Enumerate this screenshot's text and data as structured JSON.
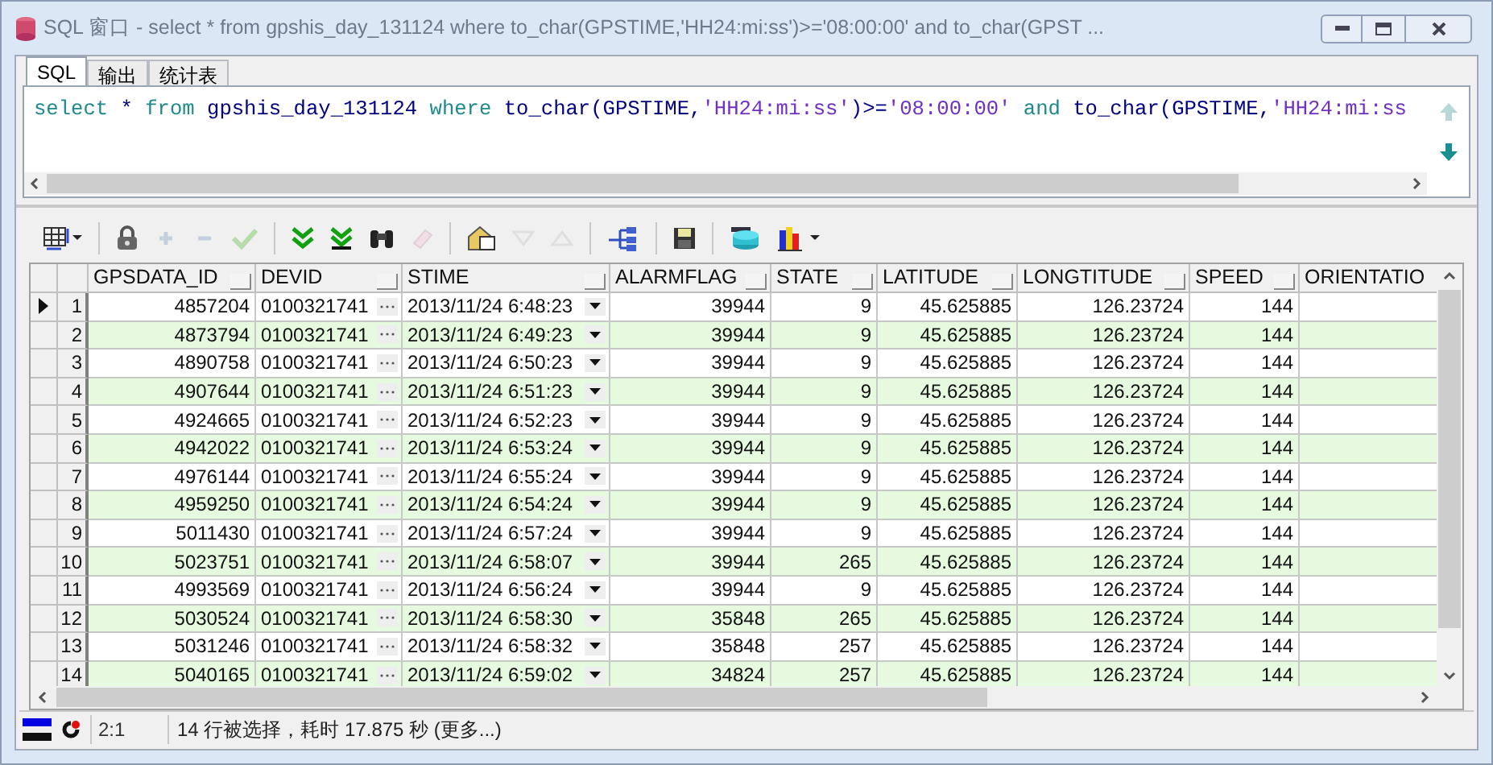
{
  "window": {
    "title": "SQL 窗口 - select * from gpshis_day_131124 where to_char(GPSTIME,'HH24:mi:ss')>='08:00:00' and to_char(GPST ..."
  },
  "tabs": [
    {
      "label": "SQL",
      "selected": true
    },
    {
      "label": "输出",
      "selected": false
    },
    {
      "label": "统计表",
      "selected": false
    }
  ],
  "sql": {
    "tokens": [
      {
        "text": "select",
        "kind": "keyword"
      },
      {
        "text": " * ",
        "kind": "plain"
      },
      {
        "text": "from",
        "kind": "keyword"
      },
      {
        "text": " gpshis_day_131124 ",
        "kind": "plain"
      },
      {
        "text": "where",
        "kind": "keyword"
      },
      {
        "text": " to_char(GPSTIME,",
        "kind": "plain"
      },
      {
        "text": "'HH24:mi:ss'",
        "kind": "string"
      },
      {
        "text": ")>=",
        "kind": "plain"
      },
      {
        "text": "'08:00:00'",
        "kind": "string"
      },
      {
        "text": " and",
        "kind": "keyword"
      },
      {
        "text": " to_char(GPSTIME,",
        "kind": "plain"
      },
      {
        "text": "'HH24:mi:ss",
        "kind": "string"
      }
    ]
  },
  "toolbar": [
    [
      {
        "kind": "grid",
        "disabled": false
      }
    ],
    [
      {
        "kind": "lock",
        "disabled": false
      },
      {
        "kind": "add",
        "disabled": true
      },
      {
        "kind": "remove",
        "disabled": true
      },
      {
        "kind": "post",
        "disabled": true
      }
    ],
    [
      {
        "kind": "fetch-next",
        "disabled": false
      },
      {
        "kind": "fetch-last",
        "disabled": false
      },
      {
        "kind": "find",
        "disabled": false
      },
      {
        "kind": "clear",
        "disabled": true
      }
    ],
    [
      {
        "kind": "query",
        "disabled": false
      },
      {
        "kind": "sort-down",
        "disabled": true
      },
      {
        "kind": "sort-up",
        "disabled": true
      }
    ],
    [
      {
        "kind": "tree",
        "disabled": false
      }
    ],
    [
      {
        "kind": "save",
        "disabled": false
      }
    ],
    [
      {
        "kind": "export",
        "disabled": false
      },
      {
        "kind": "chart",
        "disabled": false
      }
    ]
  ],
  "grid": {
    "columns": [
      {
        "label": "GPSDATA_ID",
        "kind": "number"
      },
      {
        "label": "DEVID",
        "kind": "lookup"
      },
      {
        "label": "STIME",
        "kind": "datetime"
      },
      {
        "label": "ALARMFLAG",
        "kind": "number"
      },
      {
        "label": "STATE",
        "kind": "number"
      },
      {
        "label": "LATITUDE",
        "kind": "number"
      },
      {
        "label": "LONGTITUDE",
        "kind": "number"
      },
      {
        "label": "SPEED",
        "kind": "number"
      },
      {
        "label": "ORIENTATIO"
      }
    ],
    "rows": [
      {
        "number": "1",
        "current": true,
        "cells": [
          "4857204",
          "0100321741",
          "2013/11/24 6:48:23",
          "39944",
          "9",
          "45.625885",
          "126.23724",
          "144"
        ]
      },
      {
        "number": "2",
        "current": false,
        "cells": [
          "4873794",
          "0100321741",
          "2013/11/24 6:49:23",
          "39944",
          "9",
          "45.625885",
          "126.23724",
          "144"
        ]
      },
      {
        "number": "3",
        "current": false,
        "cells": [
          "4890758",
          "0100321741",
          "2013/11/24 6:50:23",
          "39944",
          "9",
          "45.625885",
          "126.23724",
          "144"
        ]
      },
      {
        "number": "4",
        "current": false,
        "cells": [
          "4907644",
          "0100321741",
          "2013/11/24 6:51:23",
          "39944",
          "9",
          "45.625885",
          "126.23724",
          "144"
        ]
      },
      {
        "number": "5",
        "current": false,
        "cells": [
          "4924665",
          "0100321741",
          "2013/11/24 6:52:23",
          "39944",
          "9",
          "45.625885",
          "126.23724",
          "144"
        ]
      },
      {
        "number": "6",
        "current": false,
        "cells": [
          "4942022",
          "0100321741",
          "2013/11/24 6:53:24",
          "39944",
          "9",
          "45.625885",
          "126.23724",
          "144"
        ]
      },
      {
        "number": "7",
        "current": false,
        "cells": [
          "4976144",
          "0100321741",
          "2013/11/24 6:55:24",
          "39944",
          "9",
          "45.625885",
          "126.23724",
          "144"
        ]
      },
      {
        "number": "8",
        "current": false,
        "cells": [
          "4959250",
          "0100321741",
          "2013/11/24 6:54:24",
          "39944",
          "9",
          "45.625885",
          "126.23724",
          "144"
        ]
      },
      {
        "number": "9",
        "current": false,
        "cells": [
          "5011430",
          "0100321741",
          "2013/11/24 6:57:24",
          "39944",
          "9",
          "45.625885",
          "126.23724",
          "144"
        ]
      },
      {
        "number": "10",
        "current": false,
        "cells": [
          "5023751",
          "0100321741",
          "2013/11/24 6:58:07",
          "39944",
          "265",
          "45.625885",
          "126.23724",
          "144"
        ]
      },
      {
        "number": "11",
        "current": false,
        "cells": [
          "4993569",
          "0100321741",
          "2013/11/24 6:56:24",
          "39944",
          "9",
          "45.625885",
          "126.23724",
          "144"
        ]
      },
      {
        "number": "12",
        "current": false,
        "cells": [
          "5030524",
          "0100321741",
          "2013/11/24 6:58:30",
          "35848",
          "265",
          "45.625885",
          "126.23724",
          "144"
        ]
      },
      {
        "number": "13",
        "current": false,
        "cells": [
          "5031246",
          "0100321741",
          "2013/11/24 6:58:32",
          "35848",
          "257",
          "45.625885",
          "126.23724",
          "144"
        ]
      },
      {
        "number": "14",
        "current": false,
        "cells": [
          "5040165",
          "0100321741",
          "2013/11/24 6:59:02",
          "34824",
          "257",
          "45.625885",
          "126.23724",
          "144"
        ]
      }
    ]
  },
  "status_bar": {
    "position": "2:1",
    "message": "14 行被选择，耗时 17.875 秒 (更多...)"
  }
}
